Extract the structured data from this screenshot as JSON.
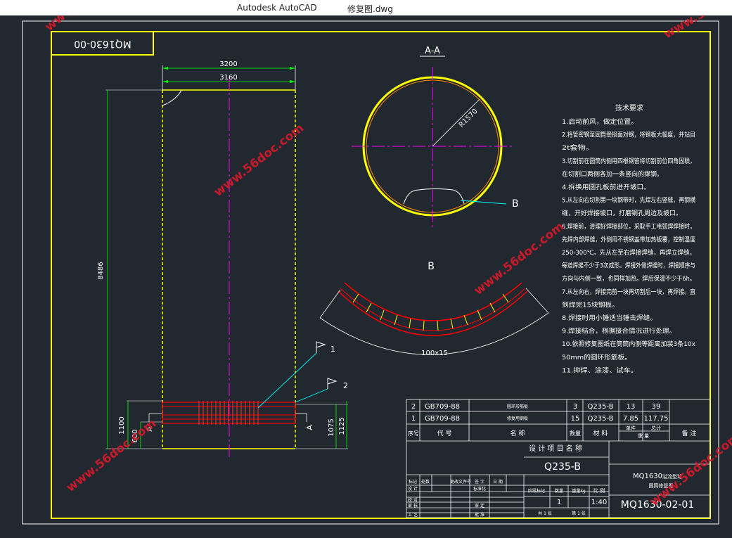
{
  "window": {
    "app_title": "Autodesk AutoCAD",
    "file_name": "修复图.dwg"
  },
  "drawing": {
    "drawing_number_box": "MQ1630-00",
    "section_label": "A-A",
    "radius_label": "R1570",
    "detail_label_b": "B",
    "detail_title_b": "B",
    "plate_size_label": "100x15",
    "dims": {
      "top_outer": "3200",
      "top_inner": "3160",
      "height": "8486",
      "bottom_left": "1100",
      "bottom_left_small": "600",
      "bottom_right_a": "1075",
      "bottom_right_b": "1125"
    },
    "section_marks": {
      "left": "A",
      "right": "A"
    },
    "leaders": {
      "one": "1",
      "two": "2"
    }
  },
  "notes": {
    "title": "技术要求",
    "lines": [
      "1.启动前风，做定位置。",
      "2.将管密钢至固筒受损面对钢，将钢板大幅度，并站目",
      "2t套物。",
      "3.切割前在圆筒内侧用四根钢管将切割前位四角固联，",
      "在切割口两侧各加一条竖向的撑钢。",
      "4.拆换用圆孔板前进开坡口。",
      "5.从左向右切割第一块钢带时，先焊左右竖缝，再钢横",
      "缝，开好焊接坡口，打磨钢孔周边及坡口。",
      "6.焊接前，清理好焊接部位，采取手工电弧焊焊接时，",
      "先焊内部焊缝，外侧用不锈钢盖带加热板覆，控制温度",
      "250-300℃。先从左至右焊接焊缝，再焊立焊缝，",
      "每道焊缝不少于3次成形。焊接外侧焊缝时，焊接顺序与",
      "方向与内侧一致，也同样加热。焊后保温不少于6h。",
      "7.从左向右，焊接完前一块再切割后一块，再焊接。直",
      "到焊完15块钢板。",
      "8.焊接时用小锤适当锤击焊缝。",
      "9.焊接结合，根据接合情况进行处理。",
      "10.依照修复图纸在筒筒内侧等距离加装3条10x",
      "50mm的圆环形筋板。",
      "11.抑焊、涂漆、试车。"
    ]
  },
  "bom": {
    "rows": [
      {
        "no": "2",
        "code": "GB709-88",
        "name": "圆环形筋板",
        "qty": "3",
        "material": "Q235-B",
        "unit_wt": "13",
        "total_wt": "39"
      },
      {
        "no": "1",
        "code": "GB709-88",
        "name": "修复用钢板",
        "qty": "15",
        "material": "Q235-B",
        "unit_wt": "7.85",
        "total_wt": "117.75"
      }
    ],
    "headers": {
      "no": "序号",
      "code": "代  号",
      "name": "名  称",
      "qty": "数量",
      "material": "材  料",
      "unit": "单件",
      "total": "总计",
      "weight": "重  量",
      "remark": "备  注"
    }
  },
  "title_block": {
    "project_label": "设 计 项 目 名 称",
    "material": "Q235-B",
    "product_name_1": "MQ1630",
    "product_name_1b": "溢流型球",
    "product_name_2": "圆筒修复图",
    "drawing_no": "MQ1630-02-01",
    "scale": "1:40",
    "qty": "1",
    "stage_label": "阶段标记",
    "qty_label": "数量",
    "weight_label": "重量kg",
    "scale_label": "比 例",
    "sheets_total": "共 1 张",
    "sheet_no": "第 1 张",
    "rows_left": [
      "标记",
      "设 计",
      "校 对",
      "审 核",
      "工 艺"
    ],
    "rows_mid": [
      "处数",
      "更改文件号",
      "签 字",
      "日 期",
      "标准化",
      "审 定",
      "批 准"
    ]
  },
  "watermarks": [
    "www.56doc.com",
    "www.56doc.com",
    "www.56doc.com",
    "www.56doc.com",
    "www.56doc.com",
    "www.56doc.com",
    "www.56doc.com",
    "www.56doc.com"
  ],
  "colors": {
    "background": "#212830",
    "frame": "#ffff00",
    "dimension": "#00ff00",
    "centerline": "#ff00ff",
    "leader": "#00ffff",
    "section": "#ff0000",
    "text": "#ffffff",
    "watermark": "#cc1020"
  }
}
